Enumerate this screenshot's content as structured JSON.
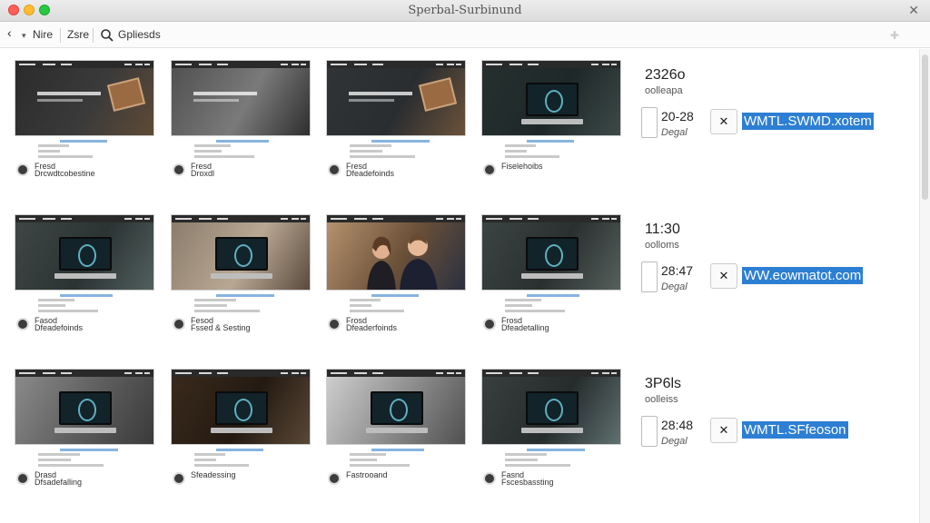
{
  "window": {
    "title": "Sperbal-Surbinund"
  },
  "toolbar": {
    "back_glyph": "‹",
    "items": [
      "Nire",
      "Zsre",
      "Gpliesds"
    ]
  },
  "icons": {
    "back": "back-arrow-icon",
    "caret": "chevron-down-icon",
    "search": "search-icon",
    "puzzle": "extension-icon",
    "close": "close-icon",
    "swap": "arrows-icon"
  },
  "rows": [
    {
      "cards": [
        {
          "caption": "Fresd\nDrcwdtcobestine"
        },
        {
          "caption": "Fresd\nDroxdl"
        },
        {
          "caption": "Fresd\nDfeadefoinds"
        },
        {
          "caption": "Fiselehoibs"
        }
      ],
      "info": {
        "time": "2326o",
        "sub": "oolleapa",
        "num": "20-28",
        "label": "Degal",
        "button": "✕",
        "link": "WMTL.SWMD.xotem"
      }
    },
    {
      "cards": [
        {
          "caption": "Fasod\nDfeadefoinds"
        },
        {
          "caption": "Fesod\nFssed & Sesting"
        },
        {
          "caption": "Frosd\nDfeaderfoinds"
        },
        {
          "caption": "Frosd\nDfeadetalling"
        }
      ],
      "info": {
        "time": "11:30",
        "sub": "oolloms",
        "num": "28:47",
        "label": "Degal",
        "button": "✕",
        "link": "WW.eowmatot.com"
      }
    },
    {
      "cards": [
        {
          "caption": "Drasd\nDfsadefalling"
        },
        {
          "caption": "Sfeadessing"
        },
        {
          "caption": "Fastrooand"
        },
        {
          "caption": "Fasnd\nFscesbassting"
        }
      ],
      "info": {
        "time": "3P6ls",
        "sub": "oolleiss",
        "num": "28:48",
        "label": "Degal",
        "button": "✕",
        "link": "WMTL.SFfeoson"
      }
    }
  ],
  "colors": {
    "accent": "#2d7fd3",
    "traffic_red": "#fe5f57",
    "traffic_yellow": "#febc2e",
    "traffic_green": "#28c840"
  }
}
